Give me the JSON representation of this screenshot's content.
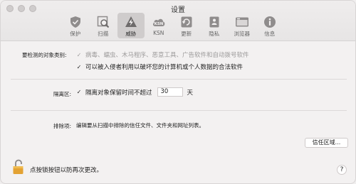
{
  "window": {
    "title": "设置"
  },
  "toolbar": {
    "items": [
      {
        "label": "保护",
        "icon": "shield-icon"
      },
      {
        "label": "扫描",
        "icon": "scan-icon"
      },
      {
        "label": "威胁",
        "icon": "threat-icon",
        "active": true
      },
      {
        "label": "KSN",
        "icon": "ksn-icon"
      },
      {
        "label": "更新",
        "icon": "update-icon"
      },
      {
        "label": "隐私",
        "icon": "privacy-icon"
      },
      {
        "label": "浏览器",
        "icon": "browser-icon"
      },
      {
        "label": "信息",
        "icon": "info-icon"
      }
    ]
  },
  "detection": {
    "label": "要检测的对象类别:",
    "option1": "病毒、蠕虫、木马程序、恶意工具、广告软件和自动拨号软件",
    "option2": "可以被入侵者利用以破坏您的计算机或个人数据的合法软件"
  },
  "quarantine": {
    "label": "隔离区:",
    "text": "隔离对象保留时间不超过",
    "days_value": "30",
    "days_unit": "天"
  },
  "exclusions": {
    "label": "排除项:",
    "text": "编辑要从扫描中排除的信任文件、文件夹和网址列表。",
    "button": "信任区域..."
  },
  "footer": {
    "lock_text": "点按锁按钮以防再次更改。",
    "help": "?"
  }
}
